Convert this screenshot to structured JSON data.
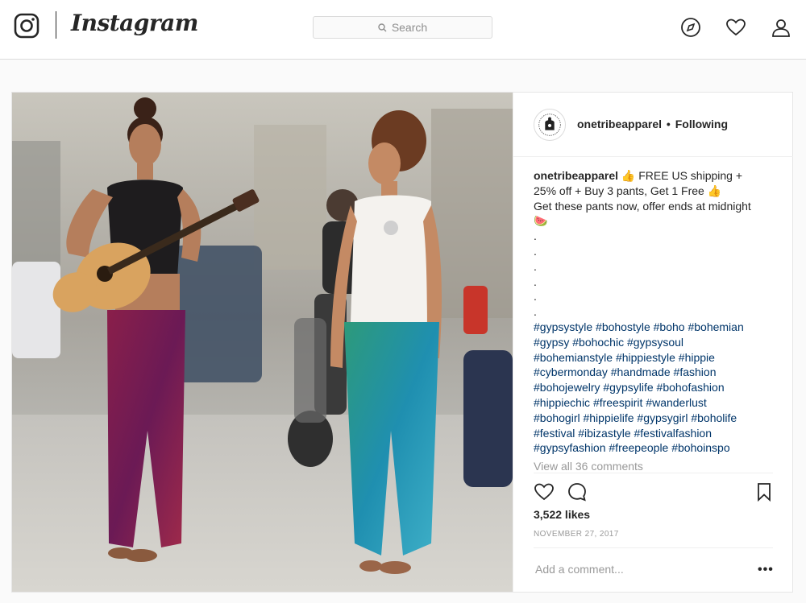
{
  "nav": {
    "wordmark": "Instagram",
    "search_placeholder": "Search",
    "icons": [
      "instagram-camera-icon",
      "explore-compass-icon",
      "activity-heart-icon",
      "profile-icon"
    ]
  },
  "post": {
    "username": "onetribeapparel",
    "separator": "•",
    "follow_status": "Following",
    "caption": {
      "lines": [
        "👍 FREE US shipping +",
        "25% off + Buy 3 pants, Get 1 Free 👍",
        "Get these pants now, offer ends at midnight",
        "🍉",
        ".",
        ".",
        ".",
        ".",
        ".",
        "."
      ],
      "hashtag_lines": [
        "#gypsystyle #bohostyle #boho #bohemian",
        "#gypsy #bohochic #gypsysoul",
        "#bohemianstyle #hippiestyle #hippie",
        "#cybermonday #handmade #fashion",
        "#bohojewelry #gypsylife #bohofashion",
        "#hippiechic #freespirit #wanderlust",
        "#bohogirl #hippielife #gypsygirl #boholife",
        "#festival #ibizastyle #festivalfashion",
        "#gypsyfashion #freepeople #bohoinspo"
      ]
    },
    "view_all_comments": "View all 36 comments",
    "likes": "3,522 likes",
    "date": "NOVEMBER 27, 2017",
    "add_comment_placeholder": "Add a comment...",
    "more_label": "•••",
    "colors": {
      "hashtag": "#003569",
      "text": "#262626",
      "muted": "#999999",
      "border": "#dbdbdb"
    }
  }
}
